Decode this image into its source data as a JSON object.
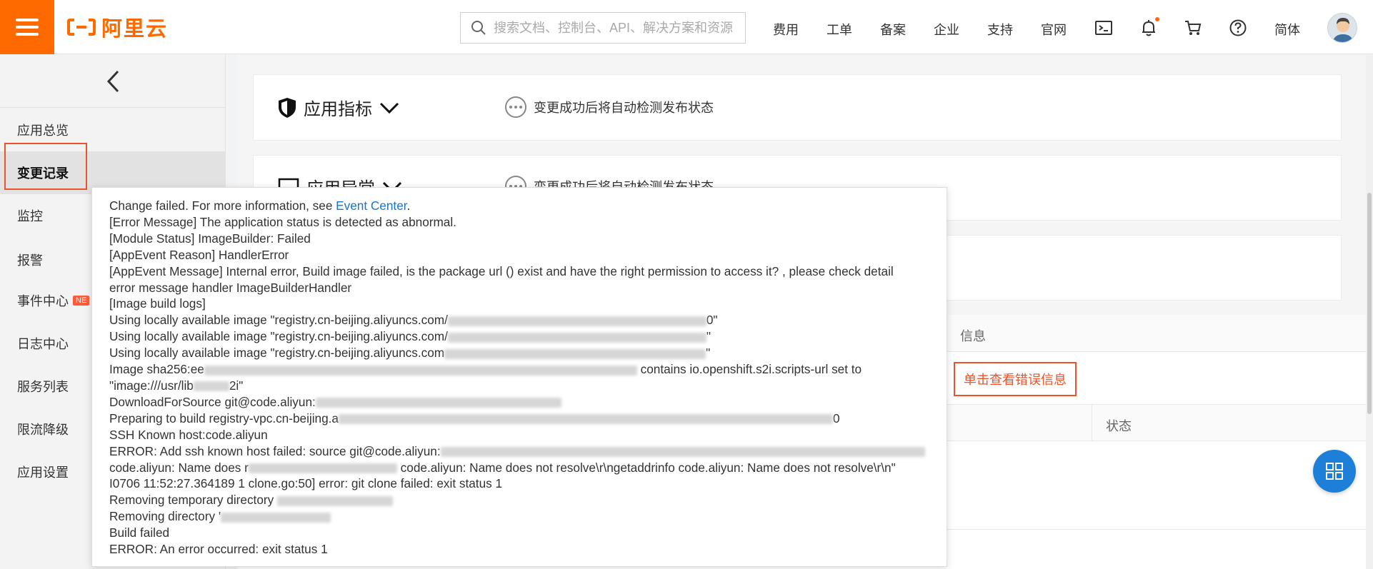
{
  "topbar": {
    "logo_text": "阿里云",
    "search_placeholder": "搜索文档、控制台、API、解决方案和资源",
    "nav": [
      "费用",
      "工单",
      "备案",
      "企业",
      "支持",
      "官网"
    ],
    "lang": "简体",
    "accent": "#ff6a00"
  },
  "sidebar": {
    "items": [
      {
        "label": "应用总览"
      },
      {
        "label": "变更记录",
        "active": true
      },
      {
        "label": "监控"
      },
      {
        "label": "报警"
      },
      {
        "label": "事件中心",
        "badge": "NE"
      },
      {
        "label": "日志中心"
      },
      {
        "label": "服务列表"
      },
      {
        "label": "限流降级"
      },
      {
        "label": "应用设置"
      }
    ]
  },
  "cards": [
    {
      "title": "应用指标",
      "status": "变更成功后将自动检测发布状态"
    },
    {
      "title": "应用异常",
      "status": "变更成功后将自动检测发布状态"
    }
  ],
  "table": {
    "header_info": "信息",
    "header_status": "状态",
    "error_link": "单击查看错误信息"
  },
  "popover": {
    "line1_prefix": "Change failed. For more information, see ",
    "line1_link": "Event Center",
    "line1_suffix": ".",
    "lines": [
      "[Error Message] The application status is detected as abnormal.",
      "[Module Status] ImageBuilder: Failed",
      "[AppEvent Reason] HandlerError",
      "[AppEvent Message] Internal error, Build image failed, is the package url () exist and have the right permission to access it? , please check detail",
      "error message handler ImageBuilderHandler",
      "[Image build logs]"
    ],
    "using1_a": "Using locally available image \"registry.cn-beijing.aliyuncs.com/",
    "using1_b": "0\"",
    "using2_a": "Using locally available image \"registry.cn-beijing.aliyuncs.com/",
    "using2_b": "\"",
    "using3_a": "Using locally available image \"registry.cn-beijing.aliyuncs.com",
    "using3_b": "\"",
    "sha_a": "Image sha256:ee",
    "sha_b": " contains io.openshift.s2i.scripts-url set to",
    "image_a": "\"image:///usr/lib",
    "image_b": "2i\"",
    "download": "DownloadForSource git@code.aliyun:",
    "prep_a": "Preparing to build registry-vpc.cn-beijing.a",
    "prep_b": "0",
    "ssh": "SSH Known host:code.aliyun",
    "error1": "ERROR: Add ssh known host failed: source git@code.aliyun:",
    "error2_a": "code.aliyun: Name does r",
    "error2_b": " code.aliyun: Name does not resolve\\r\\ngetaddrinfo code.aliyun: Name does not resolve\\r\\n\"",
    "tail": [
      "I0706 11:52:27.364189 1 clone.go:50] error: git clone failed: exit status 1"
    ],
    "remove_tmp": "Removing temporary directory ",
    "remove_dir": "Removing directory '",
    "build_failed": "Build failed",
    "final_error": "ERROR: An error occurred: exit status 1"
  }
}
